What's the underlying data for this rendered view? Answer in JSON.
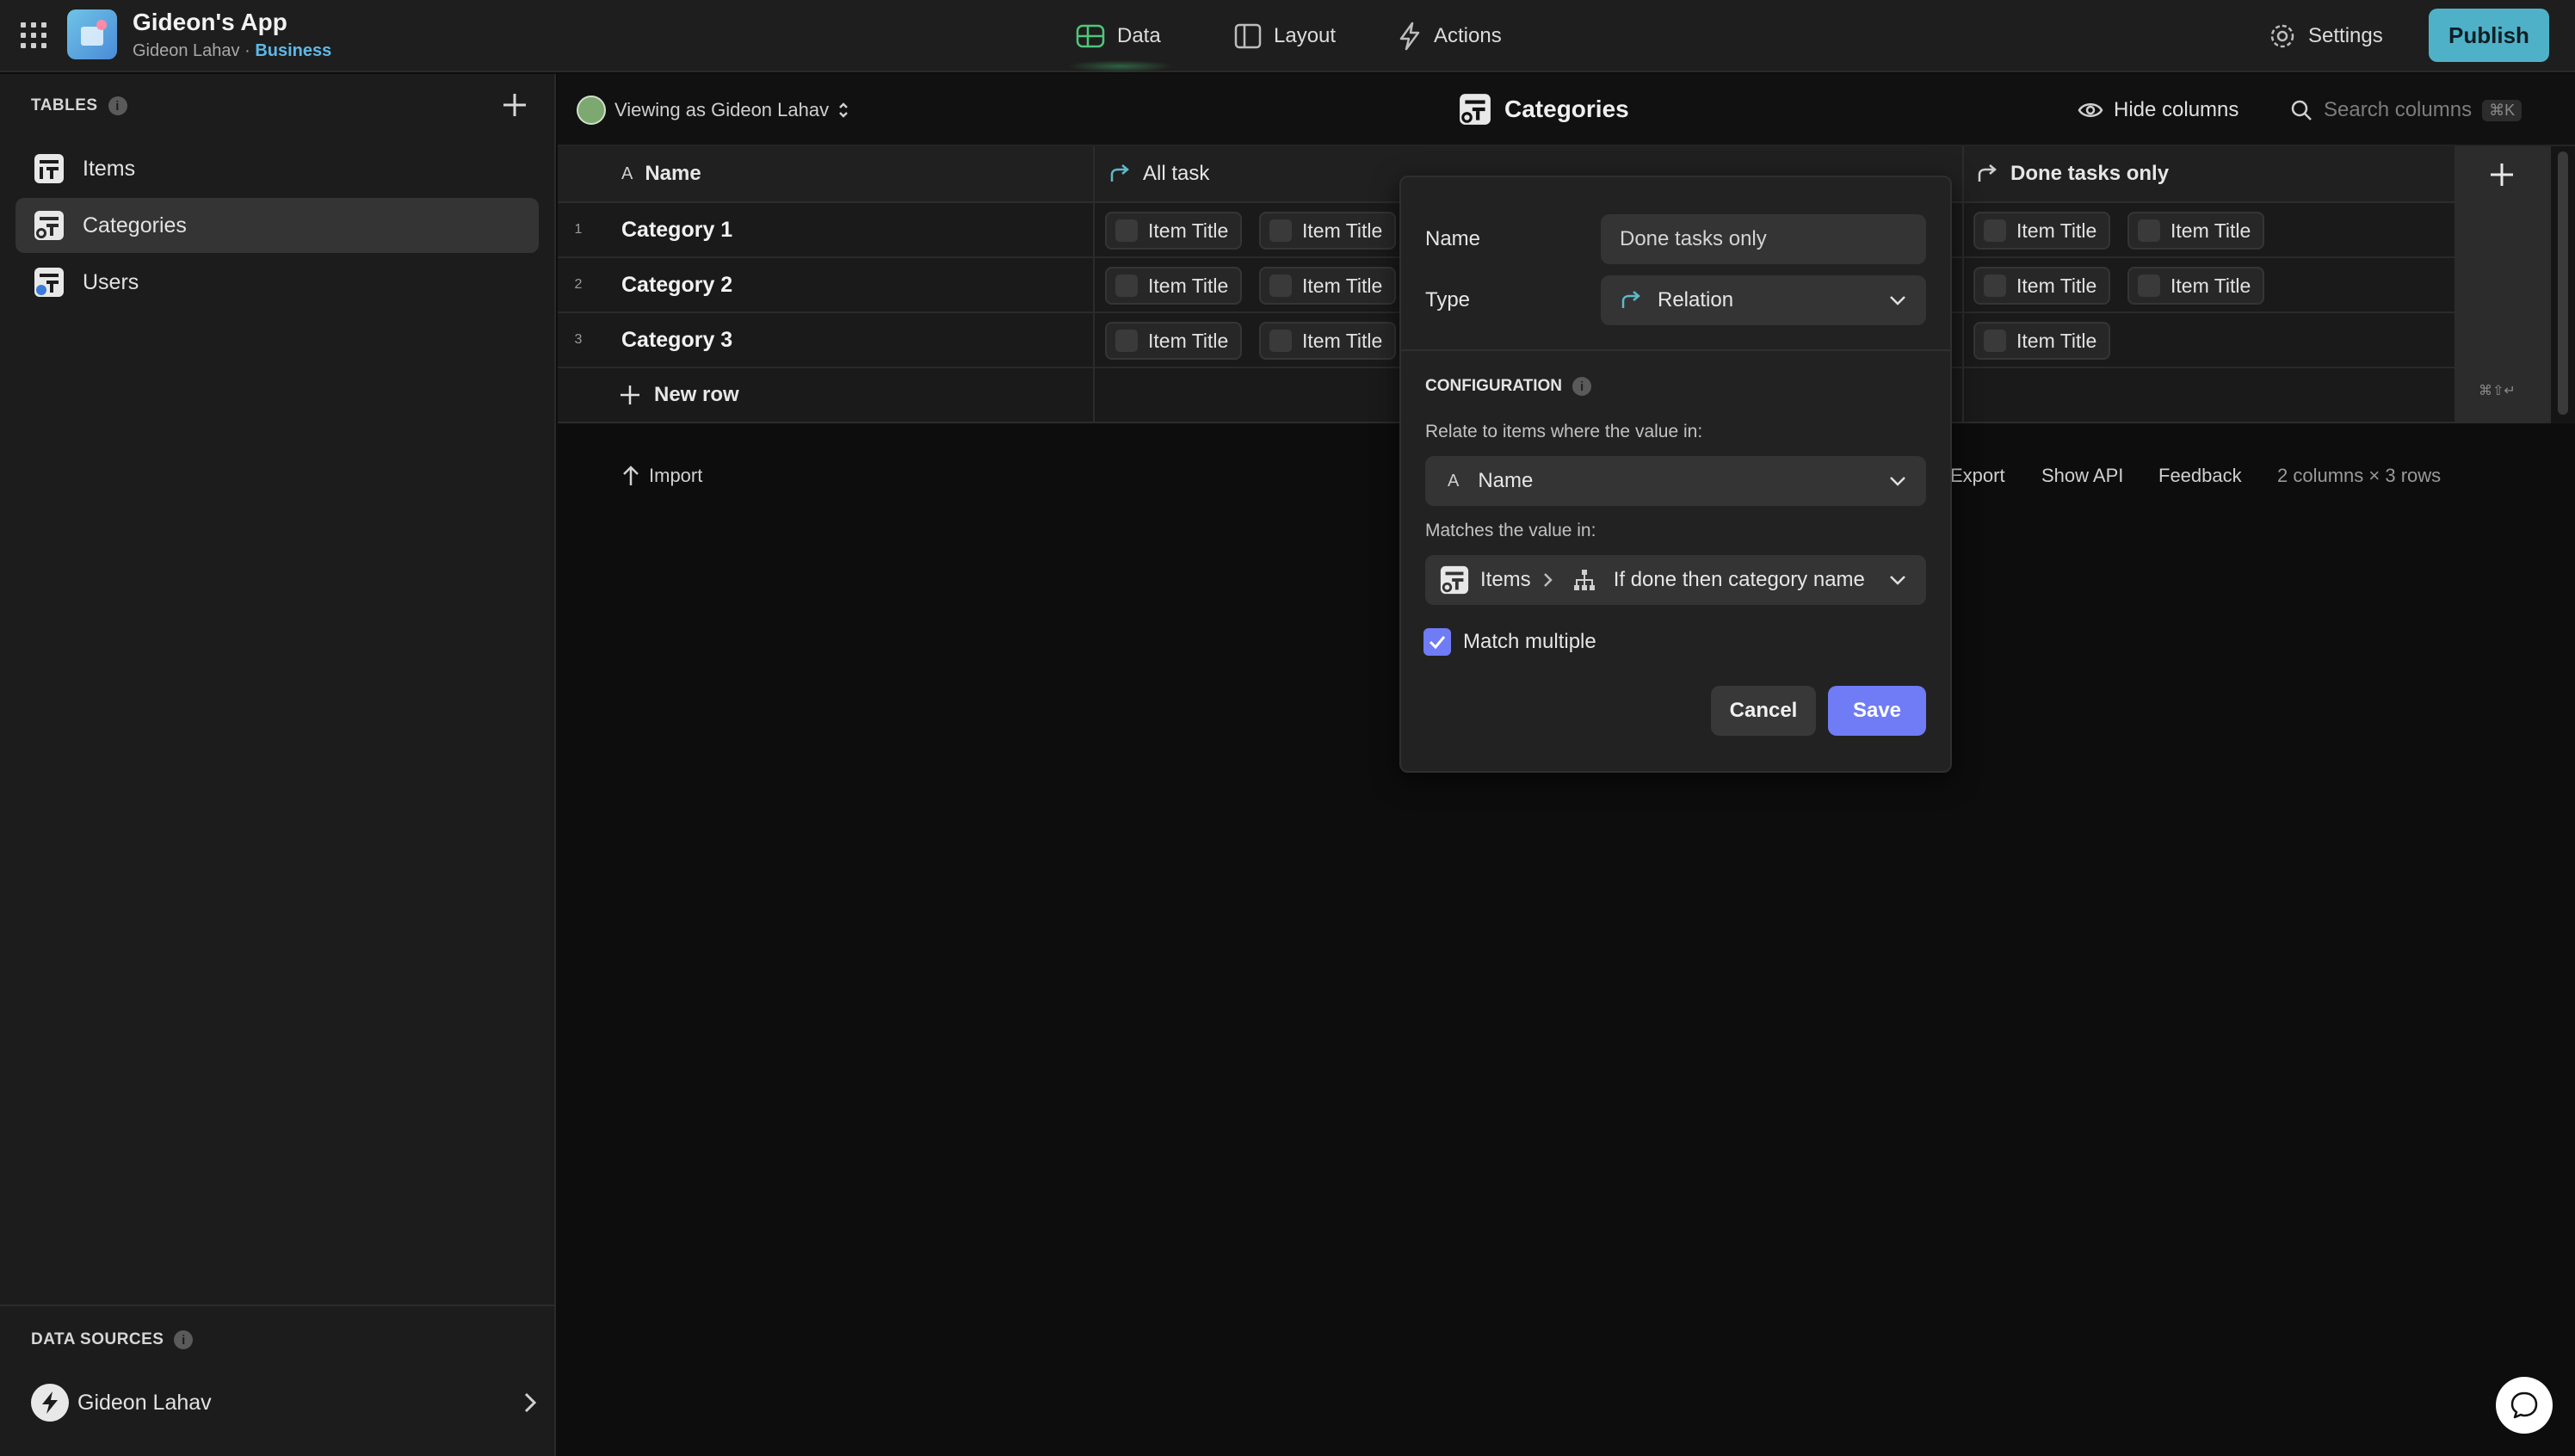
{
  "app": {
    "title": "Gideon's App",
    "owner": "Gideon Lahav",
    "separator": "·",
    "plan": "Business"
  },
  "nav": {
    "data": "Data",
    "layout": "Layout",
    "actions": "Actions",
    "settings": "Settings",
    "publish": "Publish"
  },
  "sidebar": {
    "tables_label": "TABLES",
    "items": [
      {
        "label": "Items"
      },
      {
        "label": "Categories"
      },
      {
        "label": "Users"
      }
    ],
    "data_sources_label": "DATA SOURCES",
    "data_source": "Gideon Lahav"
  },
  "toolbar": {
    "viewing_as": "Viewing as Gideon Lahav",
    "title": "Categories",
    "hide_columns": "Hide columns",
    "search_placeholder": "Search columns",
    "search_shortcut": "⌘K"
  },
  "grid": {
    "columns": [
      "Name",
      "All task",
      "Done tasks only"
    ],
    "rows": [
      {
        "num": "1",
        "name": "Category 1"
      },
      {
        "num": "2",
        "name": "Category 2"
      },
      {
        "num": "3",
        "name": "Category 3"
      }
    ],
    "chip_label": "Item Title",
    "new_row": "New row",
    "add_shortcut": "⌘⇧↵"
  },
  "footer": {
    "import": "Import",
    "export": "Export",
    "show_api": "Show API",
    "feedback": "Feedback",
    "summary": "2 columns × 3 rows"
  },
  "popover": {
    "name_label": "Name",
    "name_value": "Done tasks only",
    "type_label": "Type",
    "type_value": "Relation",
    "configuration": "CONFIGURATION",
    "relate_hint": "Relate to items where the value in:",
    "relate_value": "Name",
    "matches_hint": "Matches the value in:",
    "matches_table": "Items",
    "matches_column": "If done then category name",
    "match_multiple": "Match multiple",
    "cancel": "Cancel",
    "save": "Save"
  },
  "colors": {
    "accent": "#6f7cf5",
    "publish": "#4fb1c8",
    "plan": "#5fb8e6",
    "relation": "#5fb8c8"
  }
}
